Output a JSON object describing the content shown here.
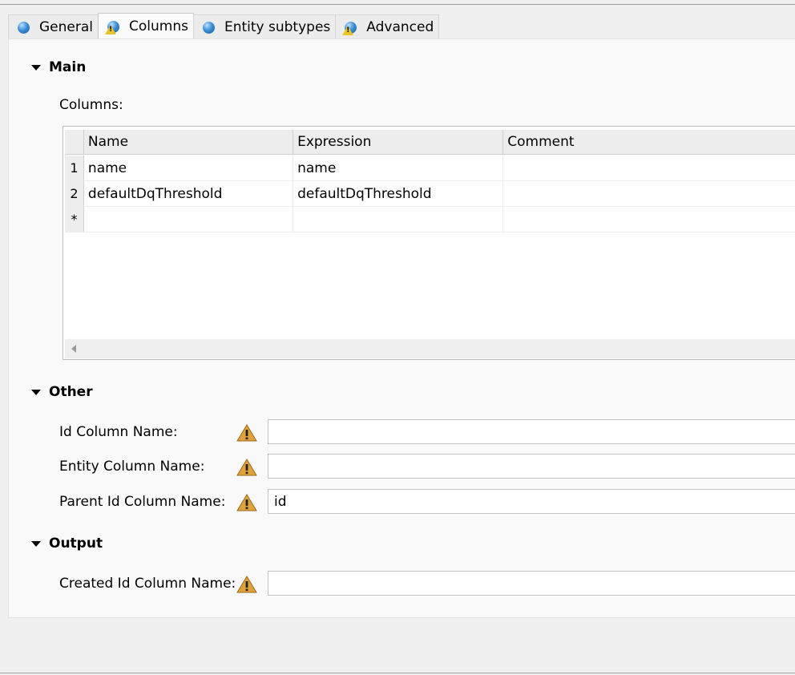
{
  "tabs": [
    {
      "label": "General",
      "icon": "info-ball-icon",
      "warning": false
    },
    {
      "label": "Columns",
      "icon": "info-ball-icon",
      "warning": true,
      "active": true
    },
    {
      "label": "Entity subtypes",
      "icon": "info-ball-icon",
      "warning": false
    },
    {
      "label": "Advanced",
      "icon": "info-ball-icon",
      "warning": true
    }
  ],
  "main": {
    "title": "Main",
    "columns_label": "Columns:",
    "table": {
      "headers": [
        "Name",
        "Expression",
        "Comment"
      ],
      "rows": [
        {
          "num": "1",
          "name": "name",
          "expression": "name",
          "comment": ""
        },
        {
          "num": "2",
          "name": "defaultDqThreshold",
          "expression": "defaultDqThreshold",
          "comment": ""
        },
        {
          "num": "*",
          "name": "",
          "expression": "",
          "comment": ""
        }
      ]
    }
  },
  "other": {
    "title": "Other",
    "fields": [
      {
        "label": "Id Column Name:",
        "value": ""
      },
      {
        "label": "Entity Column Name:",
        "value": ""
      },
      {
        "label": "Parent Id Column Name:",
        "value": "id"
      }
    ]
  },
  "output": {
    "title": "Output",
    "fields": [
      {
        "label": "Created Id Column Name:",
        "value": ""
      }
    ]
  },
  "colors": {
    "warning_icon": "#e0a23a",
    "tab_ball": "#3d8fd6"
  }
}
